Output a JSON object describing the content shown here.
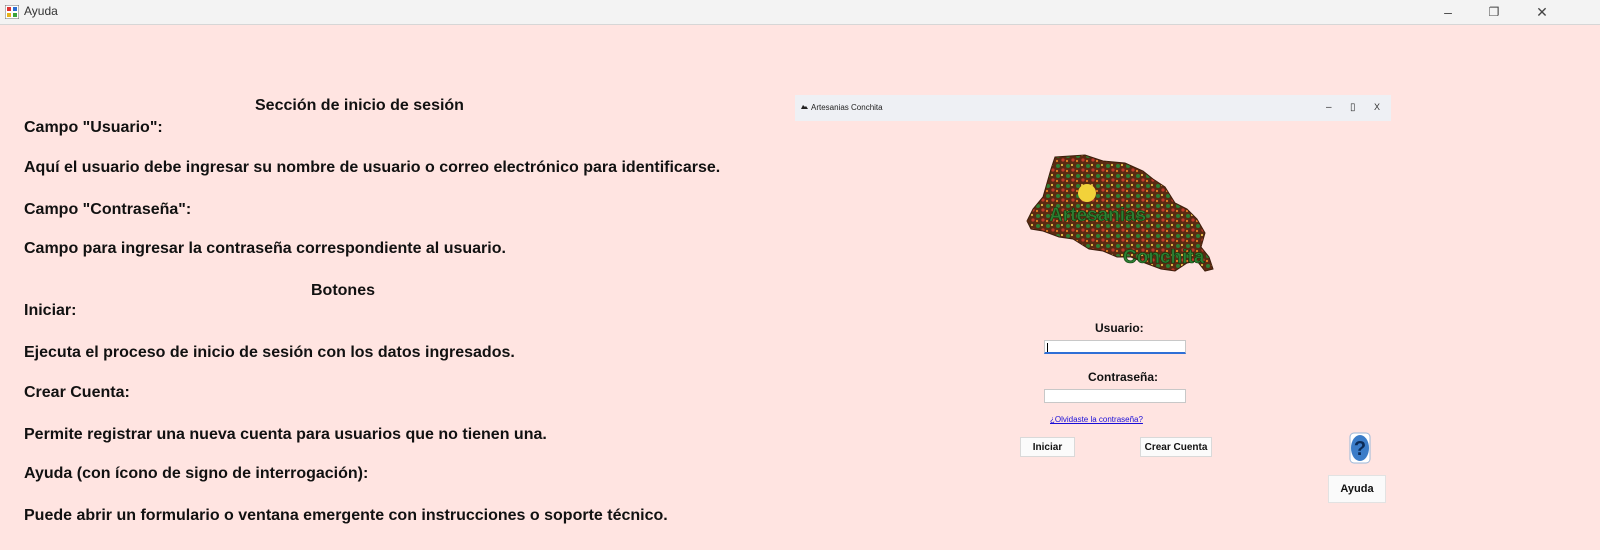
{
  "window": {
    "title": "Ayuda",
    "minimize_glyph": "–",
    "maximize_glyph": "❐",
    "close_glyph": "✕"
  },
  "help": {
    "heading_login": "Sección de inicio de sesión",
    "campo_usuario": "Campo \"Usuario\":",
    "campo_usuario_desc": "Aquí el usuario debe ingresar su nombre de usuario o correo electrónico para identificarse.",
    "campo_contrasena": "Campo \"Contraseña\":",
    "campo_contrasena_desc": "Campo para ingresar la contraseña correspondiente al usuario.",
    "heading_botones": "Botones",
    "iniciar": "Iniciar:",
    "iniciar_desc": "Ejecuta el proceso de inicio de sesión con los datos ingresados.",
    "crear_cuenta": "Crear Cuenta:",
    "crear_cuenta_desc": "Permite registrar una nueva cuenta para usuarios que no tienen una.",
    "ayuda": "Ayuda (con ícono de signo de interrogación):",
    "ayuda_desc": "Puede abrir un formulario o ventana emergente con instrucciones o soporte técnico."
  },
  "login_preview": {
    "title": "Artesanias Conchita",
    "min_glyph": "–",
    "max_glyph": "▯",
    "close_glyph": "X",
    "logo_text": [
      "Artesanias",
      "Conchita"
    ],
    "usuario_label": "Usuario:",
    "contrasena_label": "Contraseña:",
    "forgot_link": "¿Olvidaste la contraseña?",
    "iniciar_button": "Iniciar",
    "crear_cuenta_button": "Crear Cuenta",
    "ayuda_button": "Ayuda",
    "help_icon": "question-mark-icon"
  },
  "colors": {
    "background": "#ffe4e1",
    "link": "#1a0dd8",
    "help_icon": "#3a7cc8"
  }
}
